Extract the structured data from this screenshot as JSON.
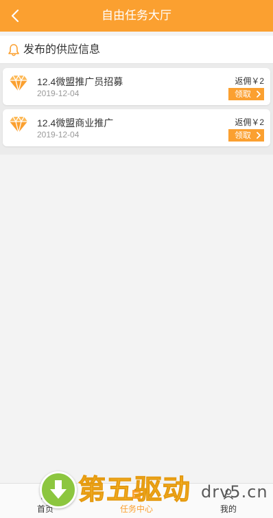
{
  "header": {
    "title": "自由任务大厅",
    "back_icon": "chevron-left-icon"
  },
  "section": {
    "title": "发布的供应信息",
    "icon": "bell-icon"
  },
  "tasks": [
    {
      "title": "12.4微盟推广员招募",
      "date": "2019-12-04",
      "rebate": "返佣￥2",
      "claim_label": "领取",
      "icon": "diamond-icon"
    },
    {
      "title": "12.4微盟商业推广",
      "date": "2019-12-04",
      "rebate": "返佣￥2",
      "claim_label": "领取",
      "icon": "diamond-icon"
    }
  ],
  "tabbar": {
    "items": [
      {
        "label": "首页",
        "icon": "home-icon"
      },
      {
        "label": "任务中心",
        "icon": "task-icon",
        "active": true
      },
      {
        "label": "我的",
        "icon": "user-icon"
      }
    ]
  },
  "watermark": {
    "brand_cn": "第五驱动",
    "brand_en": "drv5.cn"
  },
  "colors": {
    "accent": "#fba030",
    "background": "#f3f3f3",
    "watermark_green": "#8cc63f",
    "watermark_gold": "#f7b82b"
  }
}
